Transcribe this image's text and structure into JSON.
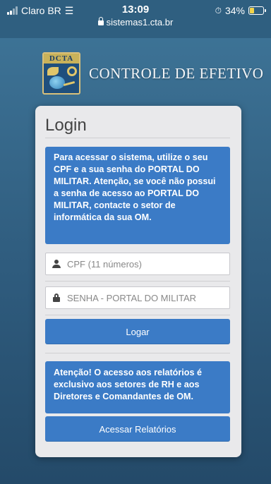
{
  "status_bar": {
    "carrier": "Claro BR",
    "time": "13:09",
    "url": "sistemas1.cta.br",
    "battery": "34%",
    "battery_level": 0.34
  },
  "brand": {
    "logo_text": "DCTA",
    "title": "CONTROLE DE EFETIVO"
  },
  "login": {
    "title": "Login",
    "info": "Para acessar o sistema, utilize o seu CPF e a sua senha do PORTAL DO MILITAR. Atenção, se você não possui a senha de acesso ao PORTAL DO MILITAR, contacte o setor de informática da sua OM.",
    "cpf_placeholder": "CPF (11 números)",
    "password_placeholder": "SENHA - PORTAL DO MILITAR",
    "submit_label": "Logar",
    "reports_notice": "Atenção! O acesso aos relatórios é exclusivo aos setores de RH e aos Diretores e Comandantes de OM.",
    "reports_button": "Acessar Relatórios"
  },
  "colors": {
    "background": "#3f7699",
    "card": "#e9e9eb",
    "primary": "#3b7bc6"
  }
}
